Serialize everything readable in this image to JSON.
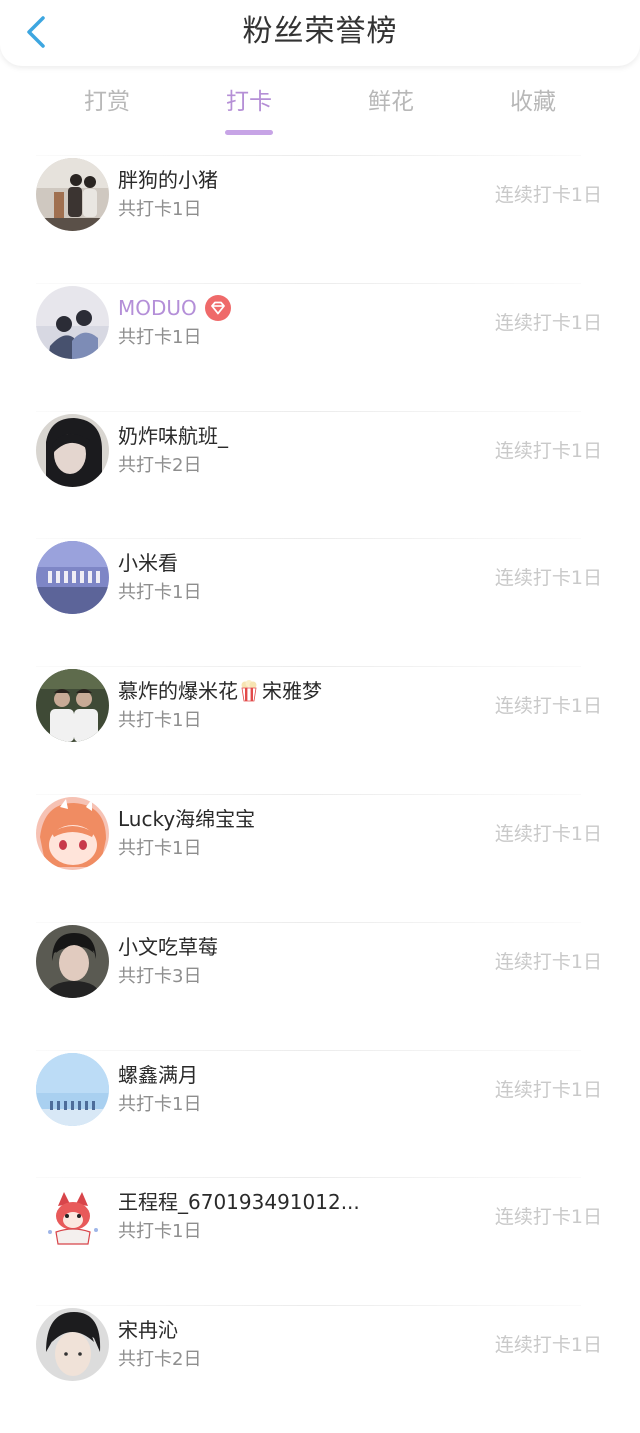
{
  "header": {
    "title": "粉丝荣誉榜"
  },
  "tabs": [
    {
      "label": "打赏",
      "active": false
    },
    {
      "label": "打卡",
      "active": true
    },
    {
      "label": "鲜花",
      "active": false
    },
    {
      "label": "收藏",
      "active": false
    }
  ],
  "colors": {
    "accent": "#b58fd6",
    "back_icon": "#3da6e0",
    "vip_badge": "#ef6a6a"
  },
  "list": [
    {
      "name": "胖狗的小猪",
      "total": "共打卡1日",
      "streak": "连续打卡1日",
      "avatar": "two-boys-photo"
    },
    {
      "name": "MODUO",
      "total": "共打卡1日",
      "streak": "连续打卡1日",
      "avatar": "couple-photo",
      "vip": true,
      "badge": "diamond-badge-icon"
    },
    {
      "name": "奶炸味航班_",
      "total": "共打卡2日",
      "streak": "连续打卡1日",
      "avatar": "girl-portrait"
    },
    {
      "name": "小米看",
      "total": "共打卡1日",
      "streak": "连续打卡1日",
      "avatar": "group-on-stage"
    },
    {
      "name": "慕炸的爆米花",
      "name_suffix": "宋雅梦",
      "total": "共打卡1日",
      "streak": "连续打卡1日",
      "avatar": "school-uniform-boys",
      "emoji": "popcorn-icon"
    },
    {
      "name": "Lucky海绵宝宝",
      "total": "共打卡1日",
      "streak": "连续打卡1日",
      "avatar": "anime-girl"
    },
    {
      "name": "小文吃草莓",
      "total": "共打卡3日",
      "streak": "连续打卡1日",
      "avatar": "boy-portrait"
    },
    {
      "name": "螺鑫满月",
      "total": "共打卡1日",
      "streak": "连续打卡1日",
      "avatar": "sky-group"
    },
    {
      "name": "王程程_670193491012...",
      "total": "共打卡1日",
      "streak": "连续打卡1日",
      "avatar": "cartoon-fox"
    },
    {
      "name": "宋冉沁",
      "total": "共打卡2日",
      "streak": "连续打卡1日",
      "avatar": "boy-closeup"
    }
  ]
}
